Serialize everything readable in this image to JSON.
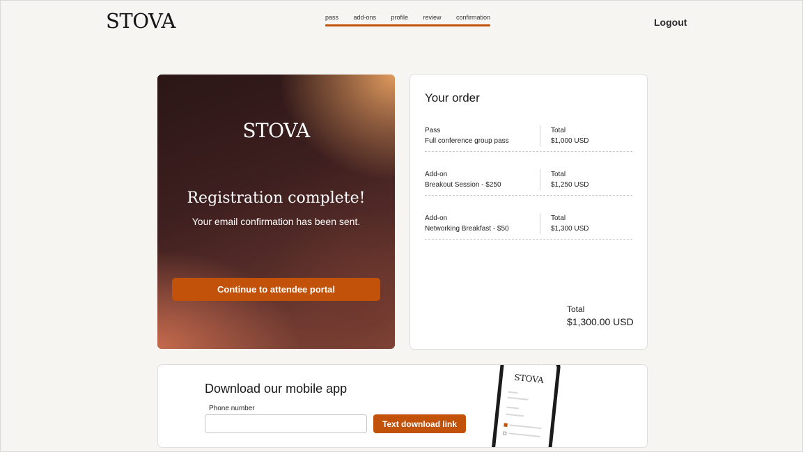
{
  "header": {
    "logo": "STOVA",
    "steps": [
      "pass",
      "add-ons",
      "profile",
      "review",
      "confirmation"
    ],
    "logout": "Logout"
  },
  "hero": {
    "logo": "STOVA",
    "title": "Registration complete!",
    "subtitle": "Your email confirmation has been sent.",
    "button": "Continue to attendee portal"
  },
  "order": {
    "title": "Your order",
    "items": [
      {
        "type": "Pass",
        "name": "Full conference group pass",
        "total_label": "Total",
        "total": "$1,000 USD"
      },
      {
        "type": "Add-on",
        "name": "Breakout Session - $250",
        "total_label": "Total",
        "total": "$1,250 USD"
      },
      {
        "type": "Add-on",
        "name": "Networking Breakfast - $50",
        "total_label": "Total",
        "total": "$1,300 USD"
      }
    ],
    "total_label": "Total",
    "total_value": "$1,300.00 USD"
  },
  "app": {
    "title": "Download our mobile app",
    "phone_label": "Phone number",
    "phone_value": "",
    "button": "Text download link",
    "phone_logo": "STOVA"
  },
  "colors": {
    "accent": "#c2520a",
    "background": "#f6f5f2"
  }
}
